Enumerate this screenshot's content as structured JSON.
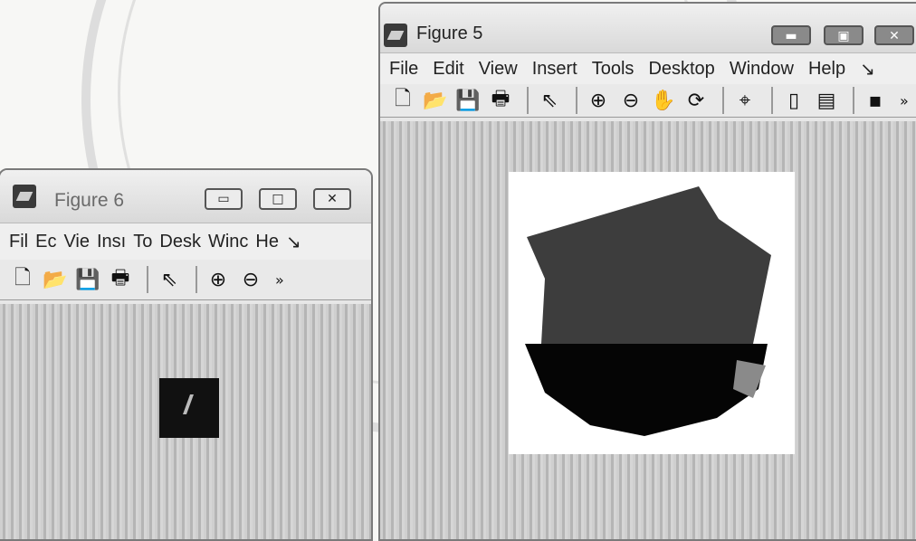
{
  "figure6": {
    "title": "Figure 6",
    "menu": [
      "Fil",
      "Ec",
      "Vie",
      "Insı",
      "To",
      "Desk",
      "Winc",
      "He",
      "↘"
    ],
    "toolbar_more": "»"
  },
  "figure5": {
    "title": "Figure 5",
    "menu": [
      "File",
      "Edit",
      "View",
      "Insert",
      "Tools",
      "Desktop",
      "Window",
      "Help",
      "↘"
    ],
    "toolbar_more": "»"
  },
  "colors": {
    "upper_region": "#3d3d3d",
    "lower_region": "#050505",
    "accent_wedge": "#8a8a8a"
  }
}
